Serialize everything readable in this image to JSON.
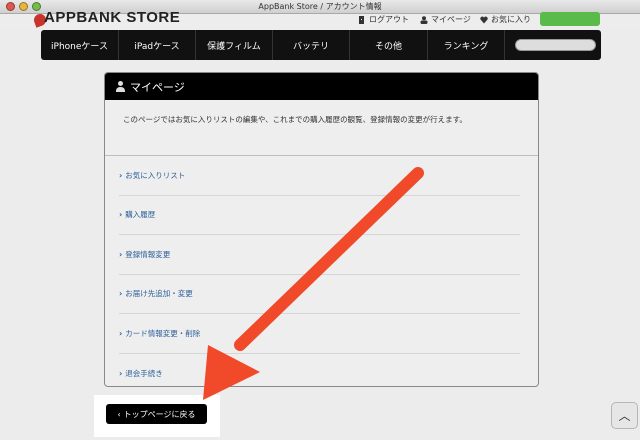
{
  "window": {
    "title": "AppBank Store / アカウント情報"
  },
  "header": {
    "logo_text": "APPBANK STORE",
    "logout_label": "ログアウト",
    "mypage_label": "マイページ",
    "favorites_label": "お気に入り"
  },
  "nav": {
    "items": [
      {
        "label": "iPhoneケース"
      },
      {
        "label": "iPadケース"
      },
      {
        "label": "保護フィルム"
      },
      {
        "label": "バッテリ"
      },
      {
        "label": "その他"
      },
      {
        "label": "ランキング"
      }
    ],
    "search_placeholder": ""
  },
  "card": {
    "title": "マイページ",
    "intro": "このページではお気に入りリストの編集や、これまでの購入履歴の観覧、登録情報の変更が行えます。",
    "links": [
      {
        "label": "お気に入りリスト"
      },
      {
        "label": "購入履歴"
      },
      {
        "label": "登録情報変更"
      },
      {
        "label": "お届け先追加・変更"
      },
      {
        "label": "カード情報変更・削除"
      },
      {
        "label": "退会手続き"
      }
    ]
  },
  "back_button": {
    "label": "トップページに戻る"
  },
  "colors": {
    "nav_bg": "#111111",
    "link": "#2a5f99",
    "annotation_arrow": "#f04a2a",
    "login_button": "#5bbb4a"
  },
  "icons": {
    "logout": "door-icon",
    "mypage": "person-icon",
    "favorites": "heart-icon",
    "scroll_top": "chevron-up-icon"
  }
}
